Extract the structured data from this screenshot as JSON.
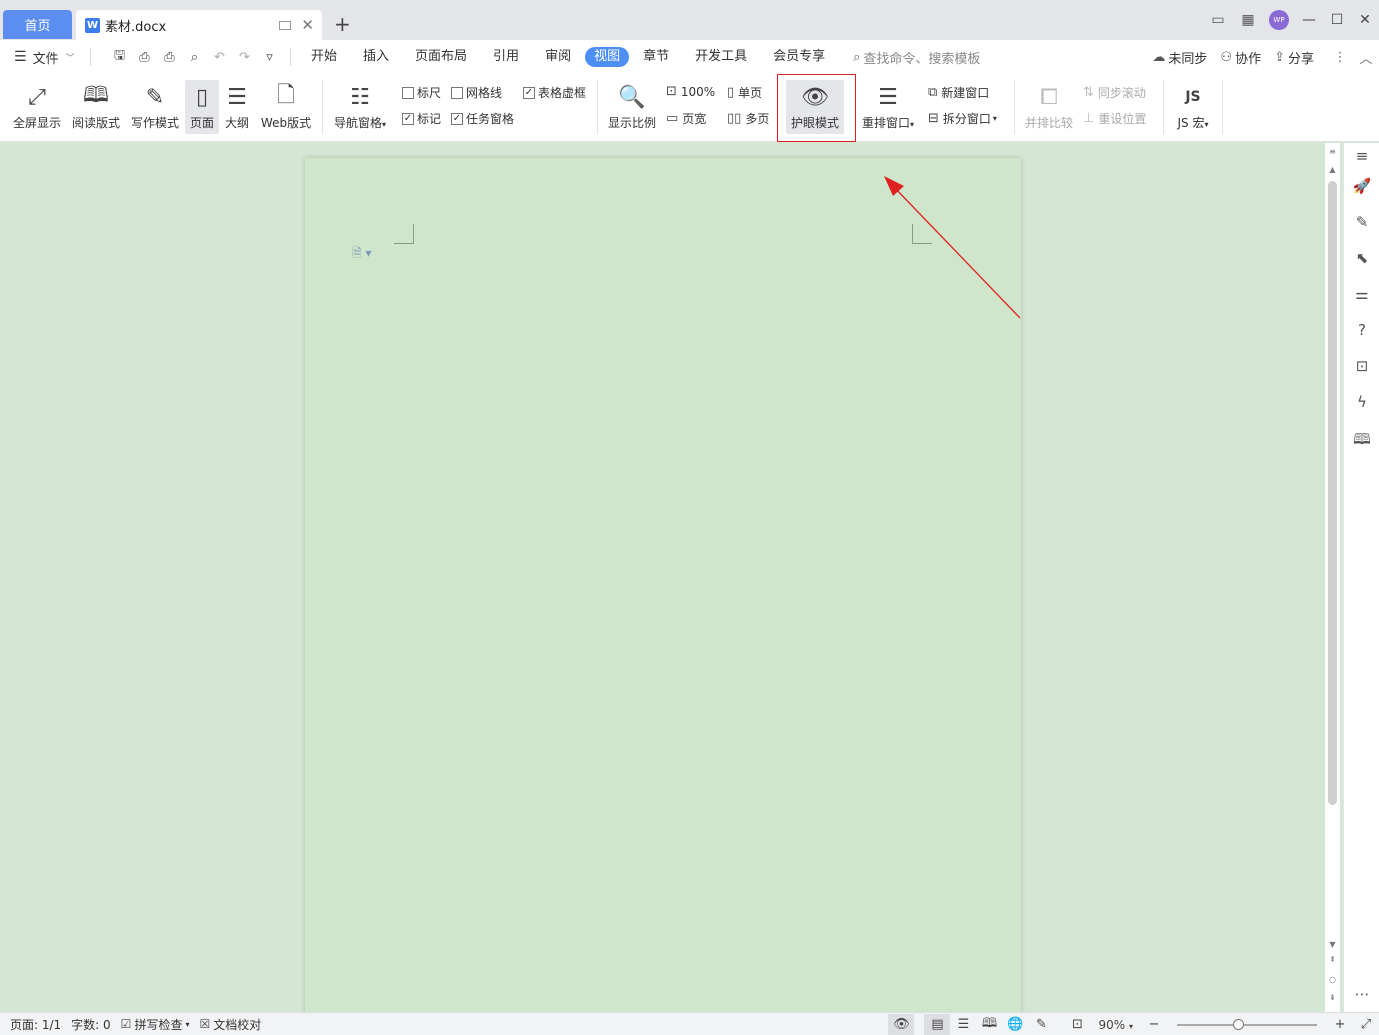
{
  "titlebar": {
    "home_tab": "首页",
    "doc_tab": "素材.docx",
    "doc_logo": "W",
    "avatar": "WP",
    "new_tab": "+"
  },
  "menubar": {
    "file": "文件",
    "tabs": [
      "开始",
      "插入",
      "页面布局",
      "引用",
      "审阅",
      "视图",
      "章节",
      "开发工具",
      "会员专享"
    ],
    "active_tab": "视图",
    "search_placeholder": "查找命令、搜索模板",
    "sync": "未同步",
    "collab": "协作",
    "share": "分享"
  },
  "ribbon": {
    "fullscreen": "全屏显示",
    "read_mode": "阅读版式",
    "write_mode": "写作模式",
    "page": "页面",
    "outline": "大纲",
    "web": "Web版式",
    "nav_pane": "导航窗格",
    "ruler": "标尺",
    "gridlines": "网格线",
    "table_border": "表格虚框",
    "marks": "标记",
    "task_pane": "任务窗格",
    "zoom": "显示比例",
    "zoom_100": "100%",
    "page_width": "页宽",
    "single_page": "单页",
    "multi_page": "多页",
    "eye_mode": "护眼模式",
    "rearrange": "重排窗口",
    "new_window": "新建窗口",
    "split_window": "拆分窗口",
    "side_by_side": "并排比较",
    "sync_scroll": "同步滚动",
    "reset_pos": "重设位置",
    "js_macro": "JS 宏"
  },
  "checkboxes": {
    "ruler": false,
    "gridlines": false,
    "table_border": true,
    "marks": true,
    "task_pane": true
  },
  "statusbar": {
    "page": "页面: 1/1",
    "words": "字数: 0",
    "spell": "拼写检查",
    "proof": "文档校对",
    "zoom": "90%"
  },
  "colors": {
    "accent": "#4d8ff4",
    "highlight": "#e02020",
    "eye_bg": "#d4e6d4",
    "page_bg": "#cfe6cb"
  }
}
